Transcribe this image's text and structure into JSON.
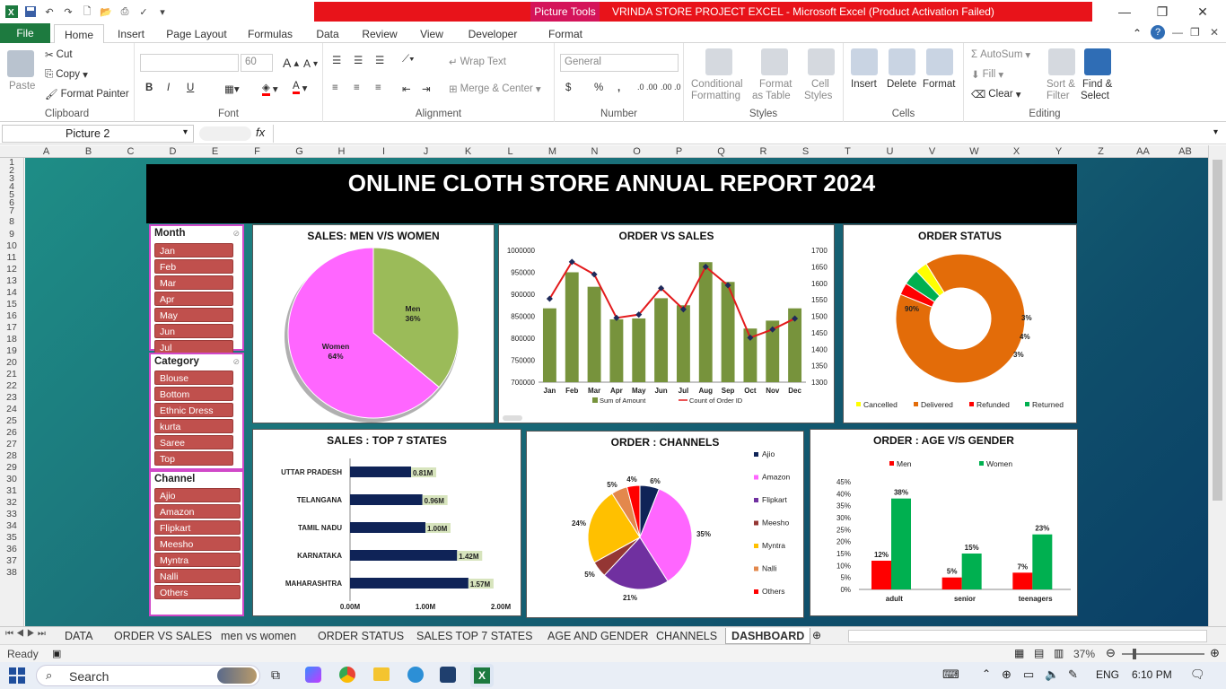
{
  "titlebar": {
    "context_tab": "Picture Tools",
    "window_title": "VRINDA STORE PROJECT EXCEL  -  Microsoft Excel (Product Activation Failed)",
    "min": "—",
    "max": "❐",
    "close": "✕"
  },
  "tabs": [
    "File",
    "Home",
    "Insert",
    "Page Layout",
    "Formulas",
    "Data",
    "Review",
    "View",
    "Developer",
    "Format"
  ],
  "ribbon": {
    "clipboard": {
      "paste": "Paste",
      "cut": "Cut",
      "copy": "Copy",
      "format_painter": "Format Painter",
      "label": "Clipboard"
    },
    "font": {
      "size": "60",
      "label": "Font",
      "bold": "B",
      "italic": "I",
      "underline": "U"
    },
    "alignment": {
      "wrap": "Wrap Text",
      "merge": "Merge & Center",
      "label": "Alignment"
    },
    "number": {
      "format": "General",
      "dollar": "$",
      "percent": "%",
      "comma": ",",
      "inc": ".0 .00",
      "dec": ".00 .0",
      "label": "Number"
    },
    "styles": {
      "cond": "Conditional",
      "cond2": "Formatting",
      "fmt_table": "Format",
      "fmt_table2": "as Table",
      "cell_styles": "Cell",
      "cell_styles2": "Styles",
      "label": "Styles"
    },
    "cells": {
      "insert": "Insert",
      "delete": "Delete",
      "format": "Format",
      "label": "Cells"
    },
    "editing": {
      "autosum": "AutoSum",
      "fill": "Fill",
      "clear": "Clear",
      "sort": "Sort &",
      "sort2": "Filter",
      "find": "Find &",
      "find2": "Select",
      "label": "Editing"
    }
  },
  "formula_bar": {
    "name_box": "Picture 2",
    "fx": "fx"
  },
  "columns": [
    "A",
    "B",
    "C",
    "D",
    "E",
    "F",
    "G",
    "H",
    "I",
    "J",
    "K",
    "L",
    "M",
    "N",
    "O",
    "P",
    "Q",
    "R",
    "S",
    "T",
    "U",
    "V",
    "W",
    "X",
    "Y",
    "Z",
    "AA",
    "AB"
  ],
  "rows": [
    "1",
    "2",
    "3",
    "4",
    "5",
    "6",
    "7",
    "8",
    "9",
    "10",
    "11",
    "12",
    "13",
    "14",
    "15",
    "16",
    "17",
    "18",
    "19",
    "20",
    "21",
    "22",
    "23",
    "24",
    "25",
    "26",
    "27",
    "28",
    "29",
    "30",
    "31",
    "32",
    "33",
    "34",
    "35",
    "36",
    "37",
    "38"
  ],
  "report_title": "ONLINE CLOTH STORE ANNUAL REPORT 2024",
  "slicers": {
    "month": {
      "title": "Month",
      "items": [
        "Jan",
        "Feb",
        "Mar",
        "Apr",
        "May",
        "Jun",
        "Jul"
      ]
    },
    "category": {
      "title": "Category",
      "items": [
        "Blouse",
        "Bottom",
        "Ethnic Dress",
        "kurta",
        "Saree",
        "Top"
      ]
    },
    "channel": {
      "title": "Channel",
      "items": [
        "Ajio",
        "Amazon",
        "Flipkart",
        "Meesho",
        "Myntra",
        "Nalli",
        "Others"
      ]
    }
  },
  "chart_data": [
    {
      "type": "pie",
      "title": "SALES: MEN V/S WOMEN",
      "categories": [
        "Men",
        "Women"
      ],
      "values": [
        36,
        64
      ],
      "labels": [
        "Men\n36%",
        "Women\n64%"
      ],
      "colors": [
        "#9bbb59",
        "#ff66ff"
      ]
    },
    {
      "type": "bar",
      "title": "ORDER VS SALES",
      "categories": [
        "Jan",
        "Feb",
        "Mar",
        "Apr",
        "May",
        "Jun",
        "Jul",
        "Aug",
        "Sep",
        "Oct",
        "Nov",
        "Dec"
      ],
      "series": [
        {
          "name": "Sum of Amount",
          "type": "bar",
          "axis": "left",
          "values": [
            868000,
            950000,
            917000,
            843000,
            845000,
            891000,
            875000,
            973000,
            928000,
            822000,
            840000,
            868000
          ],
          "color": "#77933c"
        },
        {
          "name": "Count of Order ID",
          "type": "line",
          "axis": "right",
          "values": [
            1553,
            1665,
            1627,
            1495,
            1505,
            1585,
            1521,
            1650,
            1594,
            1435,
            1460,
            1493
          ],
          "color": "#e31a1c"
        }
      ],
      "ylim": [
        700000,
        1000000
      ],
      "yticks": [
        "1000000",
        "950000",
        "900000",
        "850000",
        "800000",
        "750000",
        "700000"
      ],
      "y2lim": [
        1300,
        1700
      ],
      "y2ticks": [
        "1700",
        "1650",
        "1600",
        "1550",
        "1500",
        "1450",
        "1400",
        "1350",
        "1300"
      ]
    },
    {
      "type": "pie",
      "title": "ORDER STATUS",
      "subtype": "doughnut",
      "categories": [
        "Cancelled",
        "Delivered",
        "Refunded",
        "Returned"
      ],
      "values": [
        3,
        90,
        3,
        4
      ],
      "colors": [
        "#ffff00",
        "#e36c09",
        "#ff0000",
        "#00b050"
      ],
      "labels": [
        "3%",
        "90%",
        "3%",
        "4%"
      ]
    },
    {
      "type": "bar",
      "title": "SALES : TOP 7 STATES",
      "orientation": "horizontal",
      "categories": [
        "UTTAR PRADESH",
        "TELANGANA",
        "TAMIL NADU",
        "KARNATAKA",
        "MAHARASHTRA"
      ],
      "values": [
        0.81,
        0.96,
        1.0,
        1.42,
        1.57
      ],
      "labels": [
        "0.81M",
        "0.96M",
        "1.00M",
        "1.42M",
        "1.57M"
      ],
      "xticks": [
        "0.00M",
        "1.00M",
        "2.00M"
      ],
      "xlim": [
        0,
        2
      ],
      "color": "#0f2357"
    },
    {
      "type": "pie",
      "title": "ORDER  : CHANNELS",
      "categories": [
        "Ajio",
        "Amazon",
        "Flipkart",
        "Meesho",
        "Myntra",
        "Nalli",
        "Others"
      ],
      "values": [
        6,
        35,
        21,
        5,
        24,
        5,
        4
      ],
      "labels": [
        "6%",
        "35%",
        "21%",
        "5%",
        "24%",
        "5%",
        "4%"
      ],
      "colors": [
        "#0f2357",
        "#ff66ff",
        "#7030a0",
        "#943634",
        "#ffc000",
        "#e3884c",
        "#ff0000"
      ]
    },
    {
      "type": "bar",
      "title": "ORDER : AGE  V/S GENDER",
      "categories": [
        "adult",
        "senior",
        "teenagers"
      ],
      "series": [
        {
          "name": "Men",
          "values": [
            12,
            5,
            7
          ],
          "color": "#ff0000"
        },
        {
          "name": "Women",
          "values": [
            38,
            15,
            23
          ],
          "color": "#00b050"
        }
      ],
      "ylim": [
        0,
        45
      ],
      "yticks": [
        "45%",
        "40%",
        "35%",
        "30%",
        "25%",
        "20%",
        "15%",
        "10%",
        "5%",
        "0%"
      ]
    }
  ],
  "sheet_tabs": [
    "DATA",
    "ORDER VS SALES",
    "men vs women",
    "ORDER STATUS",
    "SALES TOP 7 STATES",
    "AGE AND GENDER",
    "CHANNELS",
    "DASHBOARD"
  ],
  "active_sheet": "DASHBOARD",
  "status": {
    "ready": "Ready",
    "zoom": "37%"
  },
  "taskbar": {
    "search": "Search",
    "lang": "ENG",
    "time": "6:10 PM"
  }
}
